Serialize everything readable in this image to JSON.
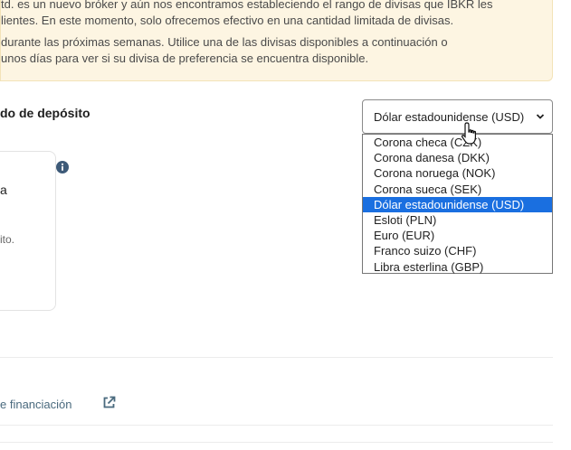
{
  "notice": {
    "lines": [
      "td. es un nuevo bróker y aún nos encontramos estableciendo el rango de divisas que IBKR les",
      "lientes. En este momento, solo ofrecemos efectivo en una cantidad limitada de divisas.",
      "durante las próximas semanas. Utilice una de las divisas disponibles a continuación o",
      " unos días para ver si su divisa de preferencia se encuentra disponible."
    ]
  },
  "section": {
    "title": "do de depósito"
  },
  "currency_select": {
    "value": "Dólar estadounidense (USD)",
    "options": [
      "Corona checa (CZK)",
      "Corona danesa (DKK)",
      "Corona noruega (NOK)",
      "Corona sueca (SEK)",
      "Dólar estadounidense (USD)",
      "Esloti (PLN)",
      "Euro (EUR)",
      "Franco suizo (CHF)",
      "Libra esterlina (GBP)"
    ],
    "selected_index": 4
  },
  "card": {
    "title": "a",
    "text": "ito."
  },
  "footer": {
    "link_text": "e financiación"
  },
  "colors": {
    "notice_bg": "#fdf5e2",
    "selected": "#1a6fe0",
    "info": "#3d5a78"
  },
  "icons": [
    "info-icon",
    "chevron-down-icon",
    "external-link-icon",
    "pointer-cursor-icon"
  ]
}
